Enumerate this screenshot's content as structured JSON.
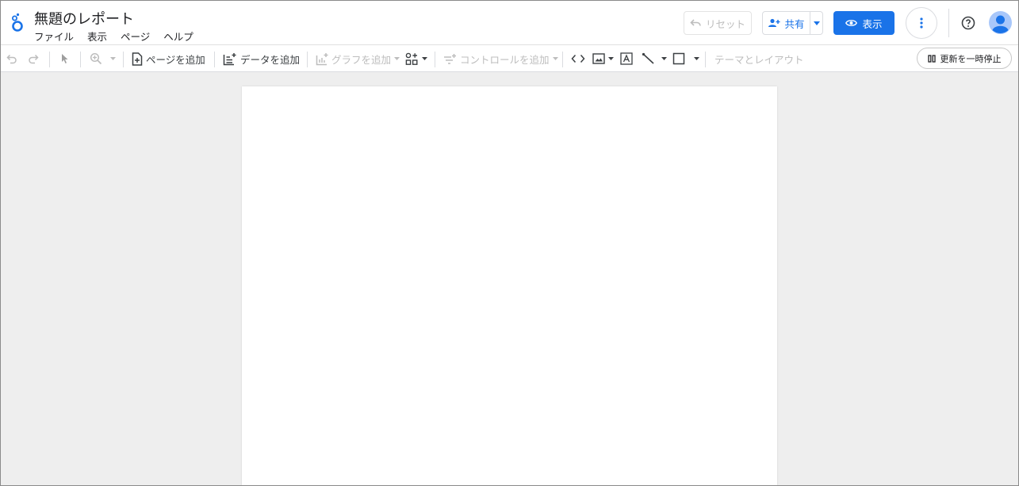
{
  "header": {
    "title": "無題のレポート",
    "menu": [
      "ファイル",
      "表示",
      "ページ",
      "ヘルプ"
    ],
    "reset_label": "リセット",
    "share_label": "共有",
    "view_label": "表示"
  },
  "toolbar": {
    "add_page_label": "ページを追加",
    "add_data_label": "データを追加",
    "add_chart_label": "グラフを追加",
    "add_control_label": "コントロールを追加",
    "theme_layout_label": "テーマとレイアウト",
    "pause_update_label": "更新を一時停止"
  },
  "colors": {
    "accent": "#1a73e8",
    "disabled": "#bdbdbd",
    "canvas_bg": "#eeeeee"
  }
}
